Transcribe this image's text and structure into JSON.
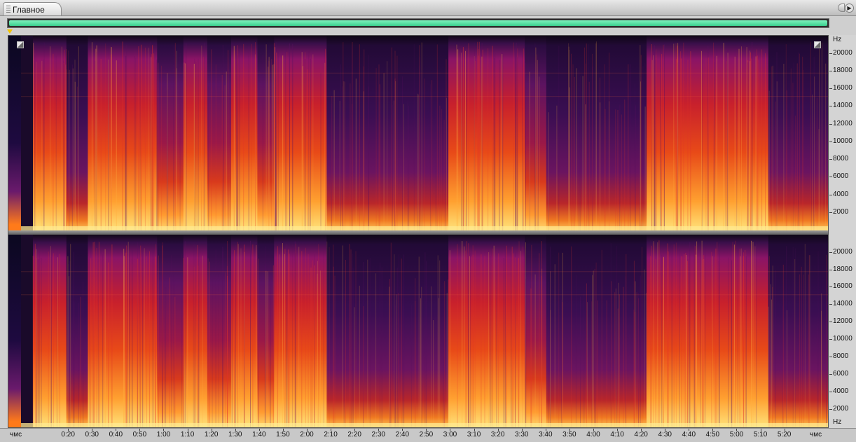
{
  "tab": {
    "label": "Главное"
  },
  "window": {
    "play_glyph": "▶"
  },
  "icons": {
    "grip": "grip-icon",
    "playhead": "playhead-marker-icon",
    "zoom": "zoom-icon"
  },
  "colors": {
    "overview_bar": "#4fe0a3",
    "playhead": "#f2c400",
    "spectrum_low": "#16081f",
    "spectrum_mid": "#7a1470",
    "spectrum_high": "#e8322c",
    "spectrum_peak": "#ffd45a"
  },
  "frequency_axis": {
    "unit_top": "Hz",
    "unit_bottom": "Hz",
    "ticks": [
      {
        "value": 20000,
        "label": "20000"
      },
      {
        "value": 18000,
        "label": "18000"
      },
      {
        "value": 16000,
        "label": "16000"
      },
      {
        "value": 14000,
        "label": "14000"
      },
      {
        "value": 12000,
        "label": "12000"
      },
      {
        "value": 10000,
        "label": "10000"
      },
      {
        "value": 8000,
        "label": "8000"
      },
      {
        "value": 6000,
        "label": "6000"
      },
      {
        "value": 4000,
        "label": "4000"
      },
      {
        "value": 2000,
        "label": "2000"
      }
    ],
    "max_hz": 22050
  },
  "time_axis": {
    "unit_left": "чмс",
    "unit_right": "чмс",
    "total_seconds": 338,
    "ticks": [
      {
        "t": 20,
        "label": "0:20"
      },
      {
        "t": 30,
        "label": "0:30"
      },
      {
        "t": 40,
        "label": "0:40"
      },
      {
        "t": 50,
        "label": "0:50"
      },
      {
        "t": 60,
        "label": "1:00"
      },
      {
        "t": 70,
        "label": "1:10"
      },
      {
        "t": 80,
        "label": "1:20"
      },
      {
        "t": 90,
        "label": "1:30"
      },
      {
        "t": 100,
        "label": "1:40"
      },
      {
        "t": 110,
        "label": "1:50"
      },
      {
        "t": 120,
        "label": "2:00"
      },
      {
        "t": 130,
        "label": "2:10"
      },
      {
        "t": 140,
        "label": "2:20"
      },
      {
        "t": 150,
        "label": "2:30"
      },
      {
        "t": 160,
        "label": "2:40"
      },
      {
        "t": 170,
        "label": "2:50"
      },
      {
        "t": 180,
        "label": "3:00"
      },
      {
        "t": 190,
        "label": "3:10"
      },
      {
        "t": 200,
        "label": "3:20"
      },
      {
        "t": 210,
        "label": "3:30"
      },
      {
        "t": 220,
        "label": "3:40"
      },
      {
        "t": 230,
        "label": "3:50"
      },
      {
        "t": 240,
        "label": "4:00"
      },
      {
        "t": 250,
        "label": "4:10"
      },
      {
        "t": 260,
        "label": "4:20"
      },
      {
        "t": 270,
        "label": "4:30"
      },
      {
        "t": 280,
        "label": "4:40"
      },
      {
        "t": 290,
        "label": "4:50"
      },
      {
        "t": 300,
        "label": "5:00"
      },
      {
        "t": 310,
        "label": "5:10"
      },
      {
        "t": 320,
        "label": "5:20"
      }
    ]
  },
  "spectrogram": {
    "channels": 2,
    "segments": [
      {
        "start": 5,
        "end": 19,
        "intensity": 0.85
      },
      {
        "start": 19,
        "end": 28,
        "intensity": 0.45
      },
      {
        "start": 28,
        "end": 39,
        "intensity": 0.85
      },
      {
        "start": 39,
        "end": 57,
        "intensity": 0.9
      },
      {
        "start": 57,
        "end": 68,
        "intensity": 0.5
      },
      {
        "start": 68,
        "end": 78,
        "intensity": 0.8
      },
      {
        "start": 78,
        "end": 88,
        "intensity": 0.55
      },
      {
        "start": 88,
        "end": 99,
        "intensity": 0.95
      },
      {
        "start": 99,
        "end": 106,
        "intensity": 0.7
      },
      {
        "start": 106,
        "end": 118,
        "intensity": 0.95
      },
      {
        "start": 118,
        "end": 128,
        "intensity": 0.75
      },
      {
        "start": 128,
        "end": 158,
        "intensity": 0.4
      },
      {
        "start": 158,
        "end": 170,
        "intensity": 0.35
      },
      {
        "start": 170,
        "end": 179,
        "intensity": 0.25
      },
      {
        "start": 179,
        "end": 211,
        "intensity": 0.9
      },
      {
        "start": 211,
        "end": 220,
        "intensity": 0.6
      },
      {
        "start": 220,
        "end": 262,
        "intensity": 0.35
      },
      {
        "start": 262,
        "end": 313,
        "intensity": 0.88
      },
      {
        "start": 313,
        "end": 326,
        "intensity": 0.3
      },
      {
        "start": 326,
        "end": 338,
        "intensity": 0.2
      }
    ]
  }
}
